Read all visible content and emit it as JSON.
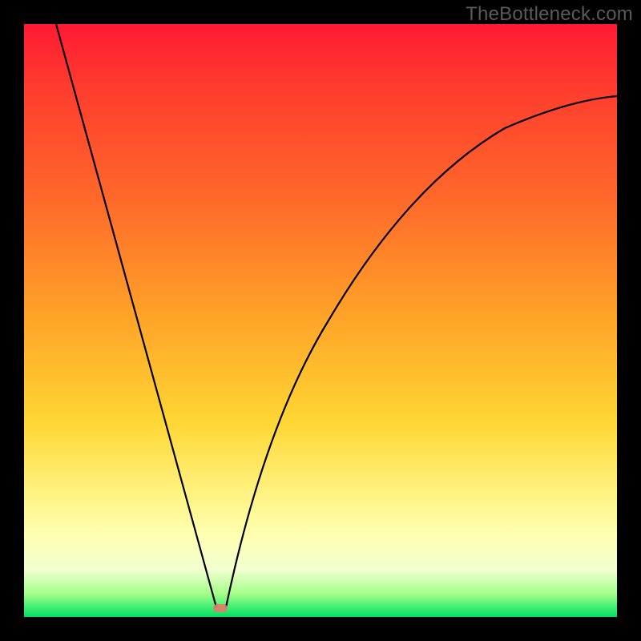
{
  "watermark": "TheBottleneck.com",
  "chart_data": {
    "type": "line",
    "title": "",
    "xlabel": "",
    "ylabel": "",
    "xlim": [
      0,
      1
    ],
    "ylim": [
      0,
      1
    ],
    "series": [
      {
        "name": "bottleneck-curve",
        "x": [
          0.0,
          0.05,
          0.1,
          0.15,
          0.2,
          0.25,
          0.3,
          0.33,
          0.35,
          0.38,
          0.42,
          0.48,
          0.55,
          0.62,
          0.7,
          0.8,
          0.9,
          1.0
        ],
        "y": [
          1.0,
          0.87,
          0.73,
          0.6,
          0.47,
          0.33,
          0.17,
          0.0,
          0.07,
          0.17,
          0.3,
          0.43,
          0.55,
          0.64,
          0.71,
          0.78,
          0.83,
          0.87
        ]
      }
    ],
    "minimum": {
      "x": 0.33,
      "y": 0.0
    },
    "gradient_stops": [
      {
        "pos": 0.0,
        "color": "#ff1a33"
      },
      {
        "pos": 0.5,
        "color": "#ffa528"
      },
      {
        "pos": 0.8,
        "color": "#fff07a"
      },
      {
        "pos": 1.0,
        "color": "#00e060"
      }
    ]
  }
}
